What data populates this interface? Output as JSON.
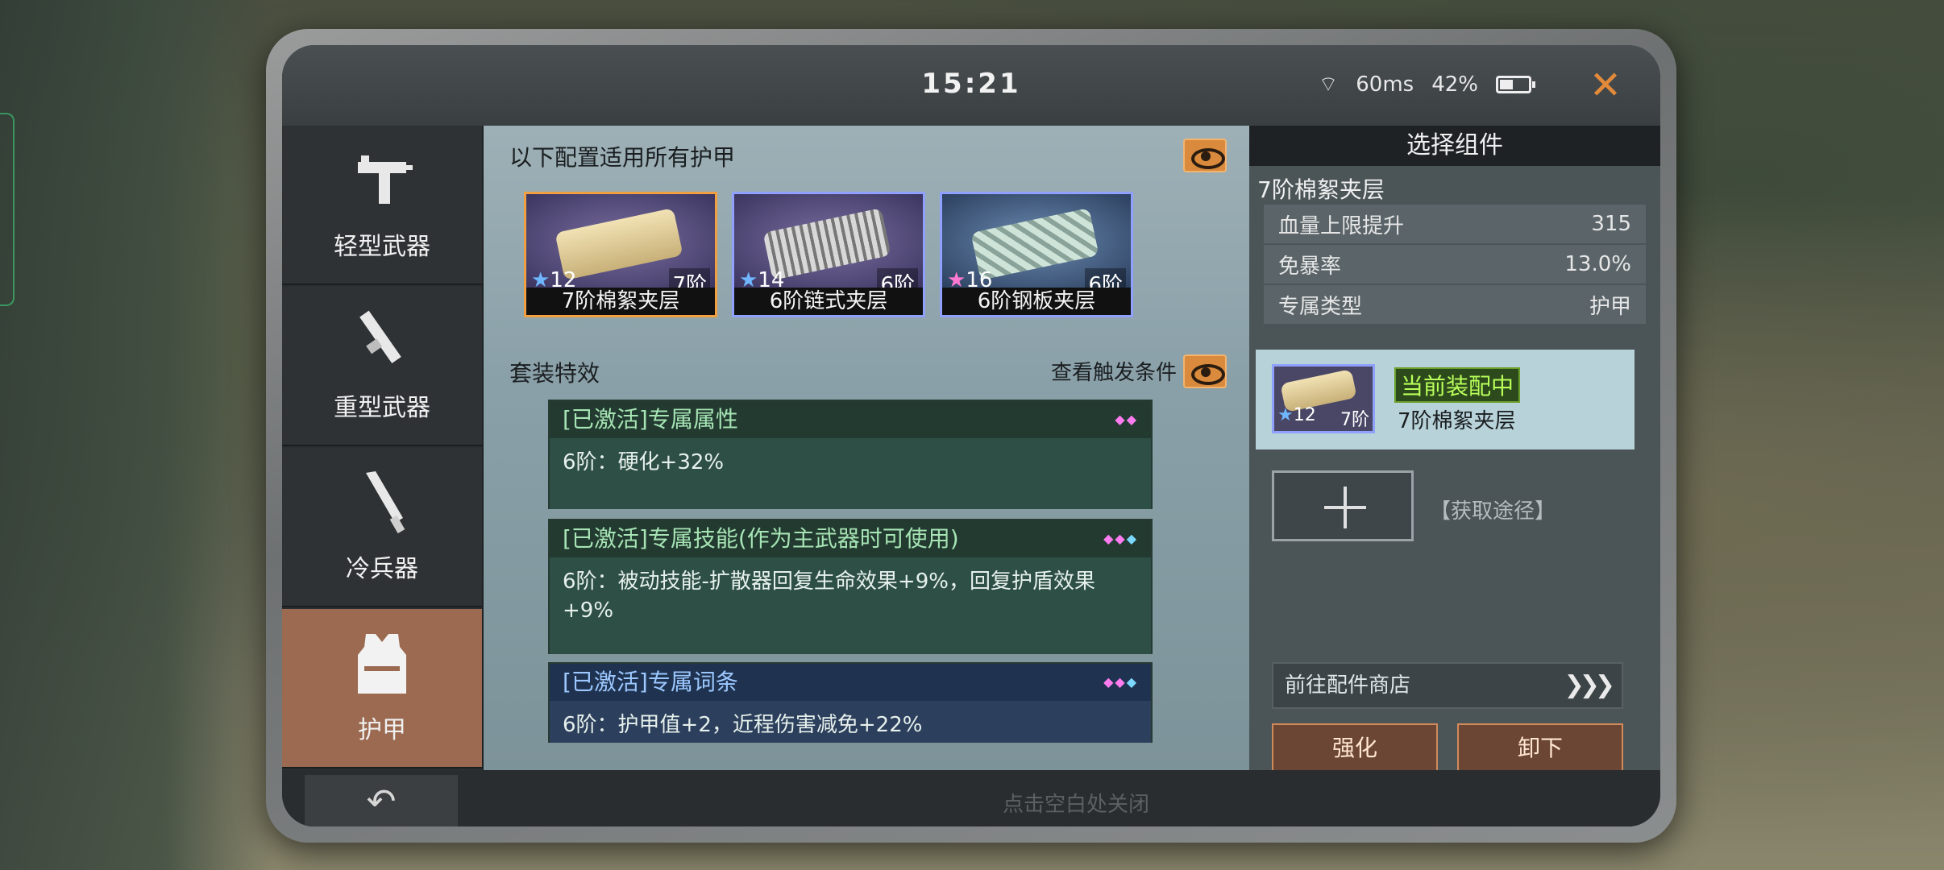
{
  "status_bar": {
    "time": "15:21",
    "ping": "60ms",
    "battery": "42%"
  },
  "sidebar": {
    "items": [
      {
        "label": "轻型武器",
        "icon": "smg-icon",
        "active": false
      },
      {
        "label": "重型武器",
        "icon": "launcher-icon",
        "active": false
      },
      {
        "label": "冷兵器",
        "icon": "knife-icon",
        "active": false
      },
      {
        "label": "护甲",
        "icon": "vest-icon",
        "active": true
      }
    ]
  },
  "middle": {
    "title": "以下配置适用所有护甲",
    "items": [
      {
        "stars": "12",
        "tier": "7阶",
        "name": "7阶棉絮夹层",
        "style": "cloth",
        "selected": true
      },
      {
        "stars": "14",
        "tier": "6阶",
        "name": "6阶链式夹层",
        "style": "chain",
        "selected": false
      },
      {
        "stars": "16",
        "tier": "6阶",
        "name": "6阶钢板夹层",
        "style": "plate",
        "selected": false
      }
    ],
    "set_title": "套装特效",
    "set_link": "查看触发条件",
    "effects": [
      {
        "head": "[已激活]专属属性",
        "body": "6阶：硬化+32%"
      },
      {
        "head": "[已激活]专属技能(作为主武器时可使用)",
        "body": "6阶：被动技能-扩散器回复生命效果+9%，回复护盾效果+9%"
      },
      {
        "head": "[已激活]专属词条",
        "body": "6阶：护甲值+2，近程伤害减免+22%"
      }
    ]
  },
  "right": {
    "title": "选择组件",
    "component_name": "7阶棉絮夹层",
    "stats": [
      {
        "label": "血量上限提升",
        "value": "315"
      },
      {
        "label": "免暴率",
        "value": "13.0%"
      },
      {
        "label": "专属类型",
        "value": "护甲"
      }
    ],
    "equipped": {
      "tag": "当前装配中",
      "name": "7阶棉絮夹层",
      "stars": "12",
      "tier": "7阶"
    },
    "acquire": "【获取途径】",
    "shop": "前往配件商店",
    "buttons": {
      "upgrade": "强化",
      "unequip": "卸下"
    }
  },
  "bottom": {
    "hint": "点击空白处关闭"
  }
}
